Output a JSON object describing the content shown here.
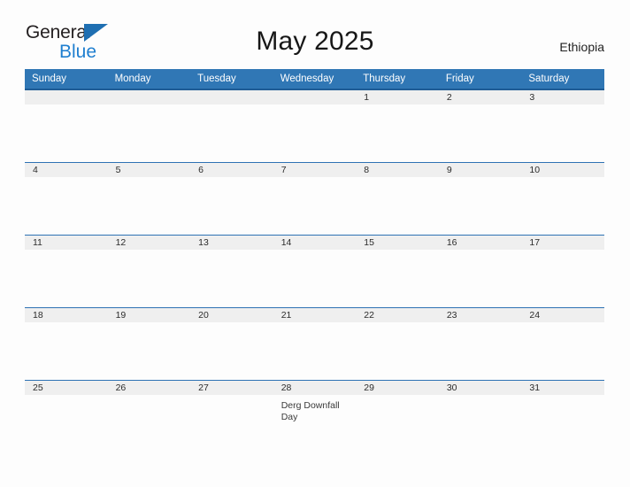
{
  "brand": {
    "name_part1": "General",
    "name_part2": "Blue",
    "flag_icon": "triangle-flag-icon",
    "accent_color": "#1f7fd0"
  },
  "header": {
    "title": "May 2025",
    "region": "Ethiopia"
  },
  "theme": {
    "header_blue": "#3077b5",
    "header_border_blue": "#1f5c96",
    "row_divider_blue": "#2e72b4",
    "date_band_gray": "#efefef",
    "page_background": "#fdfdfd"
  },
  "calendar": {
    "month": "May",
    "year": "2025",
    "weekday_headers": [
      "Sunday",
      "Monday",
      "Tuesday",
      "Wednesday",
      "Thursday",
      "Friday",
      "Saturday"
    ],
    "weeks": [
      [
        {
          "day": "",
          "events": []
        },
        {
          "day": "",
          "events": []
        },
        {
          "day": "",
          "events": []
        },
        {
          "day": "",
          "events": []
        },
        {
          "day": "1",
          "events": []
        },
        {
          "day": "2",
          "events": []
        },
        {
          "day": "3",
          "events": []
        }
      ],
      [
        {
          "day": "4",
          "events": []
        },
        {
          "day": "5",
          "events": []
        },
        {
          "day": "6",
          "events": []
        },
        {
          "day": "7",
          "events": []
        },
        {
          "day": "8",
          "events": []
        },
        {
          "day": "9",
          "events": []
        },
        {
          "day": "10",
          "events": []
        }
      ],
      [
        {
          "day": "11",
          "events": []
        },
        {
          "day": "12",
          "events": []
        },
        {
          "day": "13",
          "events": []
        },
        {
          "day": "14",
          "events": []
        },
        {
          "day": "15",
          "events": []
        },
        {
          "day": "16",
          "events": []
        },
        {
          "day": "17",
          "events": []
        }
      ],
      [
        {
          "day": "18",
          "events": []
        },
        {
          "day": "19",
          "events": []
        },
        {
          "day": "20",
          "events": []
        },
        {
          "day": "21",
          "events": []
        },
        {
          "day": "22",
          "events": []
        },
        {
          "day": "23",
          "events": []
        },
        {
          "day": "24",
          "events": []
        }
      ],
      [
        {
          "day": "25",
          "events": []
        },
        {
          "day": "26",
          "events": []
        },
        {
          "day": "27",
          "events": []
        },
        {
          "day": "28",
          "events": [
            "Derg Downfall Day"
          ]
        },
        {
          "day": "29",
          "events": []
        },
        {
          "day": "30",
          "events": []
        },
        {
          "day": "31",
          "events": []
        }
      ]
    ]
  }
}
